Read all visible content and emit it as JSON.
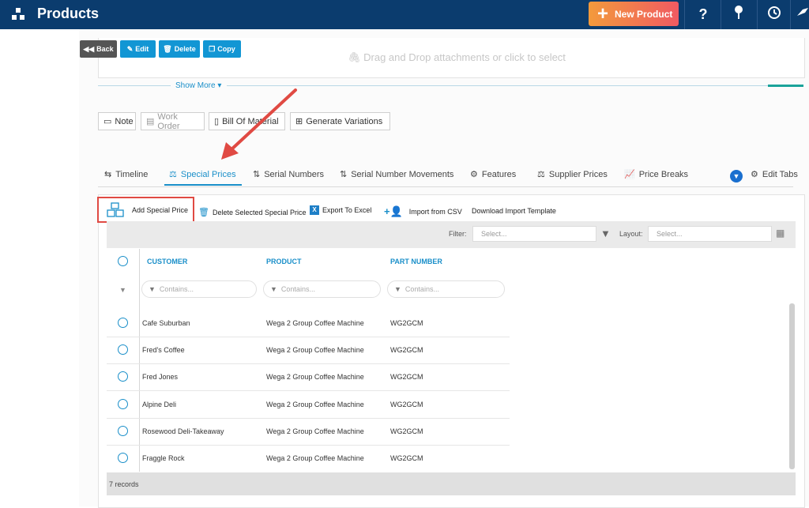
{
  "topbar": {
    "title": "Products",
    "new_button_label": "New Product"
  },
  "actions": {
    "back": "Back",
    "edit": "Edit",
    "delete": "Delete",
    "copy": "Copy"
  },
  "dropzone": {
    "text": "Drag and Drop attachments or click to select"
  },
  "show_more": "Show More",
  "doc_buttons": {
    "note": "Note",
    "work_order": "Work Order",
    "bom": "Bill Of Material",
    "variations": "Generate Variations"
  },
  "tabs": [
    {
      "label": "Timeline"
    },
    {
      "label": "Special Prices"
    },
    {
      "label": "Serial Numbers"
    },
    {
      "label": "Serial Number Movements"
    },
    {
      "label": "Features"
    },
    {
      "label": "Supplier Prices"
    },
    {
      "label": "Price Breaks"
    }
  ],
  "edit_tabs": "Edit Tabs",
  "toolbar": {
    "add": "Add Special Price",
    "delete": "Delete Selected Special Price",
    "export": "Export To Excel",
    "import": "Import from CSV",
    "template": "Download Import Template"
  },
  "filterbar": {
    "filter_label": "Filter:",
    "filter_placeholder": "Select...",
    "layout_label": "Layout:",
    "layout_placeholder": "Select..."
  },
  "table": {
    "headers": [
      "CUSTOMER",
      "PRODUCT",
      "PART NUMBER"
    ],
    "filter_placeholder": "Contains...",
    "rows": [
      {
        "customer": "Cafe Suburban",
        "product": "Wega 2 Group Coffee Machine",
        "part": "WG2GCM"
      },
      {
        "customer": "Fred's Coffee",
        "product": "Wega 2 Group Coffee Machine",
        "part": "WG2GCM"
      },
      {
        "customer": "Fred Jones",
        "product": "Wega 2 Group Coffee Machine",
        "part": "WG2GCM"
      },
      {
        "customer": "Alpine Deli",
        "product": "Wega 2 Group Coffee Machine",
        "part": "WG2GCM"
      },
      {
        "customer": "Rosewood Deli-Takeaway",
        "product": "Wega 2 Group Coffee Machine",
        "part": "WG2GCM"
      },
      {
        "customer": "Fraggle Rock",
        "product": "Wega 2 Group Coffee Machine",
        "part": "WG2GCM"
      }
    ],
    "record_count": "7 records"
  },
  "colors": {
    "topbar": "#0b3c6e",
    "accent": "#1a8fc9",
    "annotation": "#e04a43"
  }
}
